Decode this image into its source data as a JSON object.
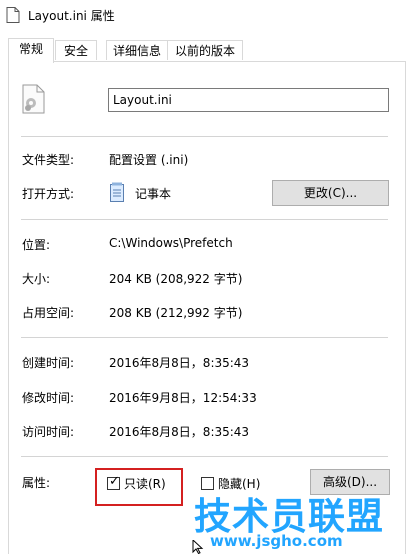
{
  "window": {
    "title": "Layout.ini 属性"
  },
  "tabs": [
    {
      "label": "常规",
      "active": true
    },
    {
      "label": "安全",
      "active": false
    },
    {
      "label": "详细信息",
      "active": false
    },
    {
      "label": "以前的版本",
      "active": false
    }
  ],
  "file": {
    "name": "Layout.ini"
  },
  "details": {
    "type_label": "文件类型:",
    "type_value": "配置设置 (.ini)",
    "open_label": "打开方式:",
    "open_value": "记事本",
    "change_button": "更改(C)...",
    "location_label": "位置:",
    "location_value": "C:\\Windows\\Prefetch",
    "size_label": "大小:",
    "size_value": "204 KB (208,922 字节)",
    "disk_label": "占用空间:",
    "disk_value": "208 KB (212,992 字节)",
    "created_label": "创建时间:",
    "created_value": "2016年8月8日，8:35:43",
    "modified_label": "修改时间:",
    "modified_value": "2016年9月8日，12:54:33",
    "accessed_label": "访问时间:",
    "accessed_value": "2016年8月8日，8:35:43"
  },
  "attributes": {
    "label": "属性:",
    "readonly_label": "只读(R)",
    "readonly_checked": true,
    "hidden_label": "隐藏(H)",
    "hidden_checked": false,
    "advanced_button": "高级(D)..."
  },
  "watermark": {
    "text": "技术员联盟",
    "url": "www.jsgho.com"
  },
  "colors": {
    "highlight": "#d42020",
    "watermark": "#22a5ff",
    "button": "#e1e1e1"
  }
}
